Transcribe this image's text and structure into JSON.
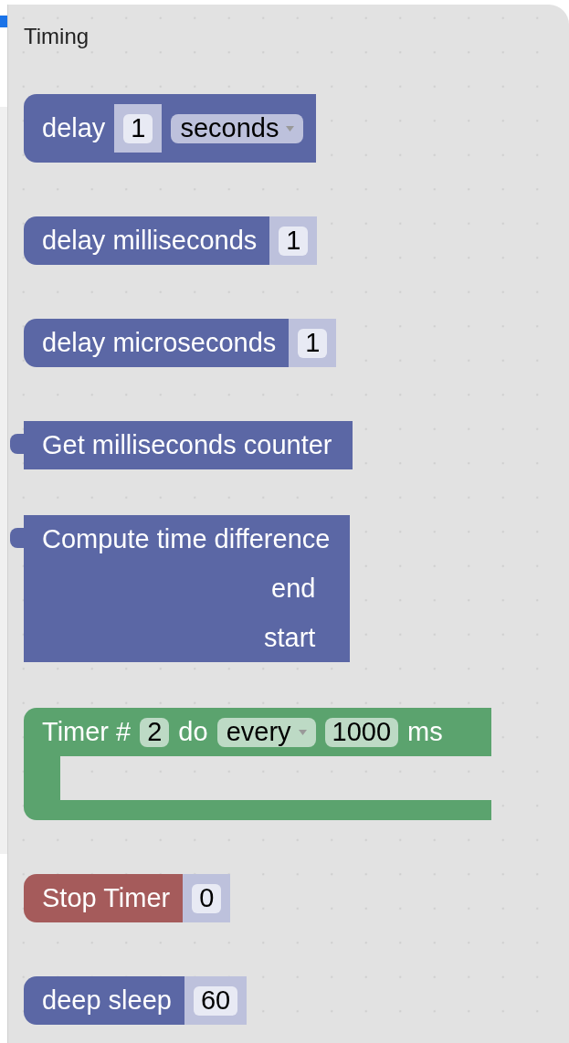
{
  "flyout": {
    "title": "Timing"
  },
  "blocks": [
    {
      "kind": "statement",
      "color": "#5b67a5",
      "parts": [
        {
          "kind": "label",
          "text": "delay"
        },
        {
          "kind": "number",
          "text": "1"
        },
        {
          "kind": "dropdown",
          "text": "seconds"
        }
      ]
    },
    {
      "kind": "statement",
      "color": "#5b67a5",
      "parts": [
        {
          "kind": "label",
          "text": "delay milliseconds"
        },
        {
          "kind": "number",
          "text": "1"
        }
      ]
    },
    {
      "kind": "statement",
      "color": "#5b67a5",
      "parts": [
        {
          "kind": "label",
          "text": "delay microseconds"
        },
        {
          "kind": "number",
          "text": "1"
        }
      ]
    },
    {
      "kind": "output",
      "color": "#5b67a5",
      "parts": [
        {
          "kind": "label",
          "text": "Get milliseconds counter"
        }
      ]
    },
    {
      "kind": "output",
      "color": "#5b67a5",
      "parts": [
        {
          "kind": "label",
          "text": "Compute time difference"
        }
      ],
      "inputs": [
        "end",
        "start"
      ]
    },
    {
      "kind": "c_block",
      "color": "#5ba36e",
      "parts": [
        {
          "kind": "label",
          "text": "Timer #"
        },
        {
          "kind": "pill",
          "text": "2"
        },
        {
          "kind": "label",
          "text": "do"
        },
        {
          "kind": "dropdown",
          "text": "every"
        },
        {
          "kind": "pill",
          "text": "1000"
        },
        {
          "kind": "label",
          "text": "ms"
        }
      ]
    },
    {
      "kind": "statement",
      "color": "#a55b5b",
      "parts": [
        {
          "kind": "label",
          "text": "Stop Timer"
        },
        {
          "kind": "number",
          "text": "0"
        }
      ]
    },
    {
      "kind": "statement",
      "color": "#5b67a5",
      "parts": [
        {
          "kind": "label",
          "text": "deep sleep"
        },
        {
          "kind": "number",
          "text": "60"
        }
      ]
    }
  ]
}
